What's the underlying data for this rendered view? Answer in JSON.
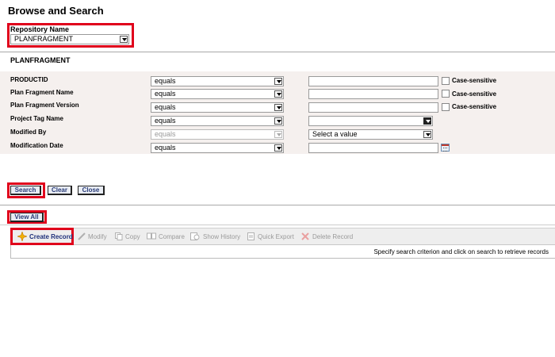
{
  "page_title": "Browse and Search",
  "repository": {
    "label": "Repository Name",
    "value": "PLANFRAGMENT"
  },
  "section_title": "PLANFRAGMENT",
  "rows": [
    {
      "label": "PRODUCTID",
      "operator": "equals",
      "case_label": "Case-sensitive"
    },
    {
      "label": "Plan Fragment Name",
      "operator": "equals",
      "case_label": "Case-sensitive"
    },
    {
      "label": "Plan Fragment Version",
      "operator": "equals",
      "case_label": "Case-sensitive"
    },
    {
      "label": "Project Tag Name",
      "operator": "equals"
    },
    {
      "label": "Modified By",
      "operator": "equals",
      "value_placeholder": "Select a value"
    },
    {
      "label": "Modification Date",
      "operator": "equals"
    }
  ],
  "buttons": {
    "search": "Search",
    "clear": "Clear",
    "close": "Close",
    "view_all": "View All"
  },
  "toolbar": {
    "create": "Create Record",
    "modify": "Modify",
    "copy": "Copy",
    "compare": "Compare",
    "show_history": "Show History",
    "quick_export": "Quick Export",
    "delete": "Delete Record"
  },
  "results_message": "Specify search criterion and click on search to retrieve records",
  "colors": {
    "highlight": "#e0001b",
    "link_blue": "#1d2f7a",
    "panel_bg": "#f5f0ee"
  }
}
